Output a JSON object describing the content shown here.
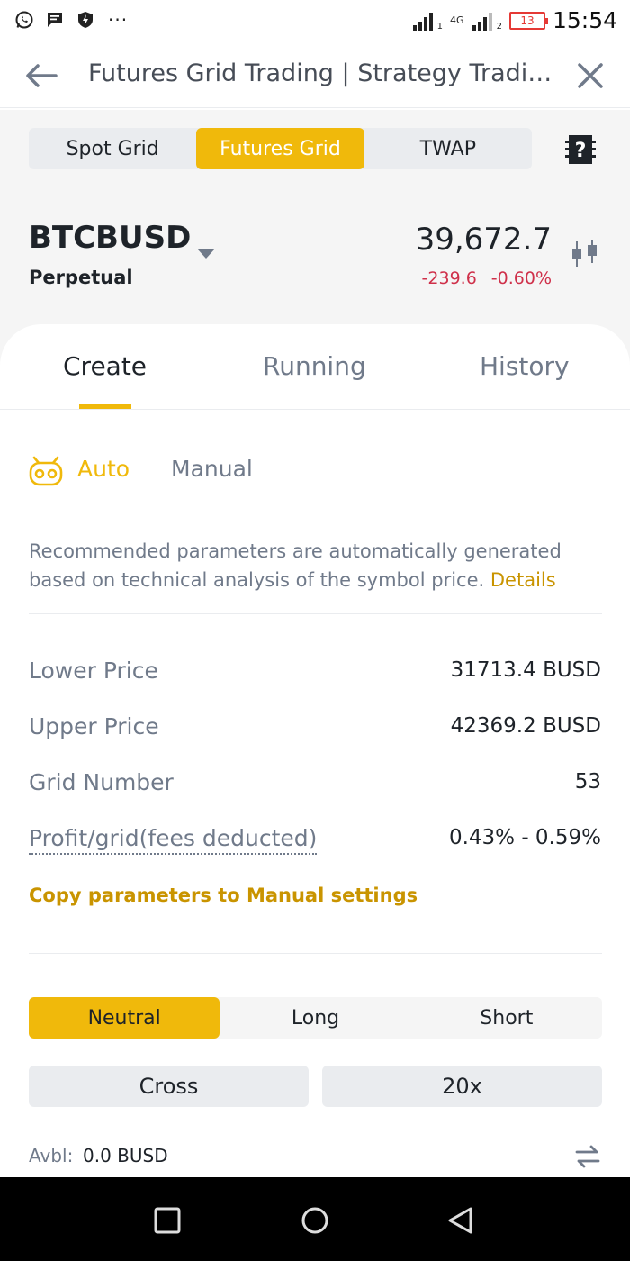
{
  "status_bar": {
    "time": "15:54",
    "battery": "13",
    "network": "4G",
    "sim1": "1",
    "sim2": "2"
  },
  "header": {
    "title": "Futures Grid Trading | Strategy Trading"
  },
  "strategy_tabs": [
    {
      "label": "Spot Grid",
      "active": false
    },
    {
      "label": "Futures Grid",
      "active": true
    },
    {
      "label": "TWAP",
      "active": false
    }
  ],
  "market": {
    "symbol": "BTCBUSD",
    "contract": "Perpetual",
    "price": "39,672.7",
    "change": "-239.6",
    "change_pct": "-0.60%"
  },
  "main_tabs": [
    {
      "label": "Create",
      "active": true
    },
    {
      "label": "Running",
      "active": false
    },
    {
      "label": "History",
      "active": false
    }
  ],
  "mode": {
    "auto": "Auto",
    "manual": "Manual",
    "selected": "Auto"
  },
  "description": {
    "text": "Recommended parameters are automatically generated based on technical analysis of the symbol price.",
    "link": "Details"
  },
  "params": [
    {
      "label": "Lower Price",
      "value": "31713.4 BUSD"
    },
    {
      "label": "Upper Price",
      "value": "42369.2 BUSD"
    },
    {
      "label": "Grid Number",
      "value": "53"
    },
    {
      "label": "Profit/grid(fees deducted)",
      "value": "0.43% - 0.59%"
    }
  ],
  "copy_link": "Copy parameters to Manual settings",
  "direction": [
    {
      "label": "Neutral",
      "active": true
    },
    {
      "label": "Long",
      "active": false
    },
    {
      "label": "Short",
      "active": false
    }
  ],
  "margin_mode": "Cross",
  "leverage": "20x",
  "available": {
    "label": "Avbl:",
    "value": "0.0 BUSD"
  },
  "colors": {
    "accent": "#f0b90b",
    "link": "#c99400",
    "negative": "#cf304a",
    "text_secondary": "#707a8a"
  }
}
